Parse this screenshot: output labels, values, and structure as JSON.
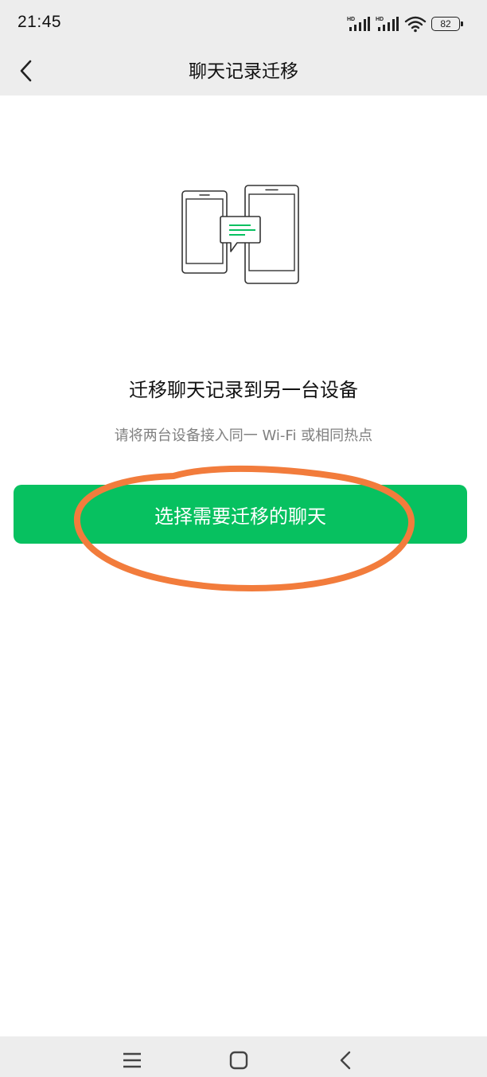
{
  "status_bar": {
    "time": "21:45",
    "battery_level": "82",
    "network_badges": [
      "HD",
      "HD"
    ],
    "icons": [
      "signal-hd-icon",
      "signal-hd-icon",
      "wifi-icon",
      "battery-icon"
    ]
  },
  "nav": {
    "title": "聊天记录迁移",
    "back_icon": "chevron-left-icon"
  },
  "content": {
    "illustration_icon": "phones-transfer-illustration",
    "headline": "迁移聊天记录到另一台设备",
    "subtext": "请将两台设备接入同一 Wi-Fi 或相同热点",
    "primary_button_label": "选择需要迁移的聊天"
  },
  "system_nav": {
    "icons": [
      "menu-icon",
      "home-icon",
      "back-icon"
    ]
  },
  "colors": {
    "accent": "#07c160",
    "annotation": "#f27c3c",
    "bar_background": "#ededed"
  }
}
